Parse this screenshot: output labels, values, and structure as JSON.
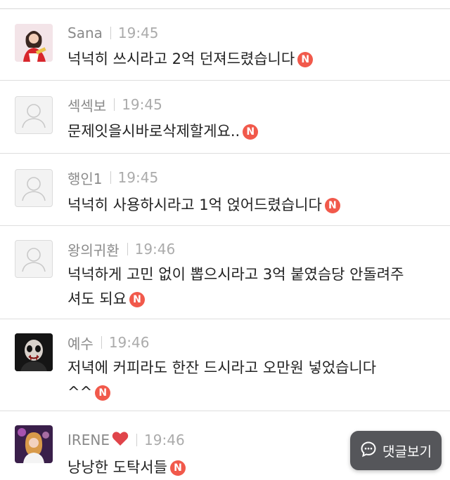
{
  "badge_letter": "N",
  "view_comments_button": {
    "label": "댓글보기",
    "icon": "chat-bubble-icon"
  },
  "colors": {
    "badge": "#f1594b",
    "button_bg": "#46484c",
    "author": "#8a8a8a",
    "time": "#ababab"
  },
  "comments": [
    {
      "author": "Sana",
      "time": "19:45",
      "avatar": "photo",
      "text": "넉넉히 쓰시라고 2억 던져드렸습니다"
    },
    {
      "author": "섹섹보",
      "time": "19:45",
      "avatar": "default-user-icon",
      "text": "문제잇을시바로삭제할게요.."
    },
    {
      "author": "행인1",
      "time": "19:45",
      "avatar": "default-user-icon",
      "text": "넉넉히 사용하시라고 1억 얹어드렸습니다"
    },
    {
      "author": "왕의귀환",
      "time": "19:46",
      "avatar": "default-user-icon",
      "text_line1": "넉넉하게 고민 없이 뽑으시라고 3억 붙였슴당 안돌려주",
      "text_line2": "셔도 되요"
    },
    {
      "author": "예수",
      "time": "19:46",
      "avatar": "photo",
      "text_line1": "저녁에 커피라도 한잔 드시라고 오만원 넣었습니다",
      "text_line2": "^^"
    },
    {
      "author": "IRENE",
      "author_suffix_icon": "heart-icon",
      "time": "19:46",
      "avatar": "photo",
      "text": "낭낭한 도탁서들"
    }
  ]
}
